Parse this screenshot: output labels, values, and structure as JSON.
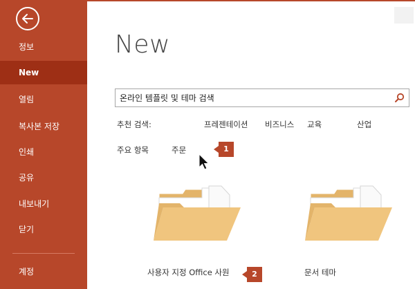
{
  "sidebar": {
    "back_label": "",
    "items": [
      {
        "label": "정보"
      },
      {
        "label": "New"
      },
      {
        "label": "열림"
      },
      {
        "label": "복사본 저장"
      },
      {
        "label": "인쇄"
      },
      {
        "label": "공유"
      },
      {
        "label": "내보내기"
      },
      {
        "label": "닫기"
      },
      {
        "label": "계정"
      }
    ]
  },
  "main": {
    "title": "New",
    "search": {
      "value": "온라인 템플릿 및 테마 검색",
      "placeholder": "온라인 템플릿 및 테마 검색"
    },
    "suggested_label": "추천 검색:",
    "suggested": [
      "프레젠테이션",
      "비즈니스",
      "교육",
      "산업"
    ],
    "tabs": [
      "주요 항목",
      "주문"
    ],
    "tiles": [
      {
        "label": "사용자 지정 Office 사원"
      },
      {
        "label": "문서 테마"
      }
    ]
  },
  "callouts": [
    "1",
    "2"
  ],
  "colors": {
    "accent": "#b7472a",
    "accent_dark": "#9e2f15",
    "folder": "#f0c57e",
    "folder_dark": "#e3b46a"
  },
  "icons": {
    "back": "arrow-left-circle-icon",
    "search": "search-icon",
    "folder": "folder-icon",
    "cursor": "mouse-pointer-icon"
  }
}
